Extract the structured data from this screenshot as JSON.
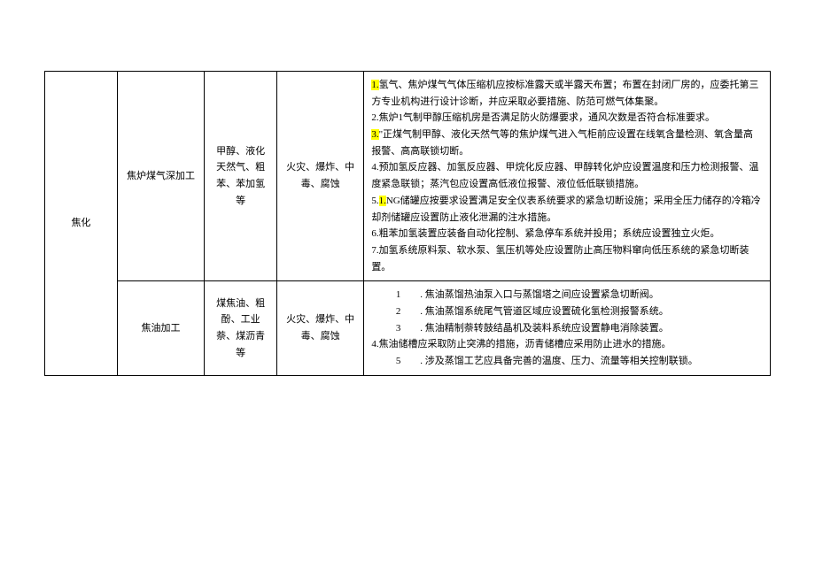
{
  "table": {
    "category": "焦化",
    "rows": [
      {
        "sub": "焦炉煤气深加工",
        "materials": "甲醇、液化天然气、粗苯、苯加氢等",
        "hazards": "火灾、爆炸、中毒、腐蚀",
        "measures": [
          {
            "pre": "1.",
            "hl": true,
            "text": "氢气、焦炉煤气气体压缩机应按标准露天或半露天布置；布置在封闭厂房的，应委托第三方专业机构进行设计诊断，并应采取必要措施、防范可燃气体集聚。"
          },
          {
            "pre": "",
            "hl": false,
            "text": "2.焦炉1气制甲醇压缩机房是否满足防火防爆要求，通风次数是否符合标准要求。"
          },
          {
            "pre": "3.",
            "hl": true,
            "text": "\"正煤气制甲醇、液化天然气等的焦炉煤气进入气柜前应设置在线氧含量检测、氧含量高报警、高高联锁切断。"
          },
          {
            "pre": "",
            "hl": false,
            "text": "4.预加氢反应器、加氢反应器、甲烷化反应器、甲醇转化炉应设置温度和压力检测报警、温度紧急联锁；蒸汽包应设置高低液位报警、液位低低联锁措施。"
          },
          {
            "pre": "5.",
            "hl_inline": "1.",
            "text": "NG储罐应按要求设置满足安全仪表系统要求的紧急切断设施；采用全压力储存的冷箱冷却剂储罐应设置防止液化泄漏的注水措施。"
          },
          {
            "pre": "",
            "hl": false,
            "text": "6.粗苯加氢装置应装备自动化控制、紧急停车系统并投用；系统应设置独立火炬。"
          },
          {
            "pre": "",
            "hl": false,
            "text": "7.加氢系统原料泵、软水泵、氢压机等处应设置防止高压物料窜向低压系统的紧急切断装置。"
          }
        ]
      },
      {
        "sub": "焦油加工",
        "materials": "煤焦油、粗酚、工业萘、煤沥青等",
        "hazards": "火灾、爆炸、中毒、腐蚀",
        "measures": [
          {
            "pre": "",
            "indented": true,
            "text": "1　　. 焦油蒸馏热油泵入口与蒸馏塔之间应设置紧急切断阀。"
          },
          {
            "pre": "",
            "indented": true,
            "text": "2　　. 焦油蒸馏系统尾气管道区域应设置硫化氢检测报警系统。"
          },
          {
            "pre": "",
            "indented": true,
            "text": "3　　. 焦油精制萘转鼓结晶机及装料系统应设置静电消除装置。"
          },
          {
            "pre": "",
            "indented": false,
            "text": "4.焦油储槽应采取防止突沸的措施，沥青储槽应采用防止进水的措施。"
          },
          {
            "pre": "",
            "indented": true,
            "text": "5　　. 涉及蒸馏工艺应具备完善的温度、压力、流量等相关控制联锁。"
          }
        ]
      }
    ]
  }
}
